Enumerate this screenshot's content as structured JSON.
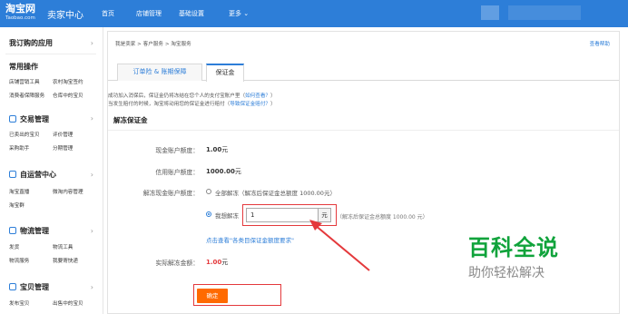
{
  "topbar": {
    "logo": "淘宝网",
    "logo_sub": "Taobao.com",
    "seller_center": "卖家中心",
    "nav": [
      "首页",
      "店铺管理",
      "基础设置",
      "更多 ⌄"
    ]
  },
  "sidebar": {
    "title": "我订购的应用",
    "common_ops": "常用操作",
    "common_items": [
      "店铺营销工具",
      "农村淘宝签约",
      "消费者保障服务",
      "仓库中的宝贝"
    ],
    "sections": [
      {
        "title": "交易管理",
        "items": [
          "已卖出的宝贝",
          "评价管理",
          "采购助手",
          "分期管理"
        ]
      },
      {
        "title": "自运营中心",
        "items": [
          "淘宝直播",
          "微淘内容管理",
          "淘宝群"
        ]
      },
      {
        "title": "物流管理",
        "items": [
          "发货",
          "物流工具",
          "物流服务",
          "我要寄快递"
        ]
      },
      {
        "title": "宝贝管理",
        "items": [
          "发布宝贝",
          "出售中的宝贝"
        ]
      }
    ]
  },
  "main": {
    "breadcrumb": [
      "我是卖家",
      "客户服务",
      "淘宝服务"
    ],
    "help": "查看帮助",
    "tabs": [
      "订单险 & 账期保障",
      "保证金"
    ],
    "tip_line1": "成功加入消保后，保证金仍将冻结在您个人的支付宝账户里（",
    "tip_link1": "如何查看？",
    "tip_line1_end": "）",
    "tip_line2": "当发生赔付的时候，淘宝将动用您的保证金进行赔付（",
    "tip_link2": "导致保证金赔付？",
    "tip_line2_end": "）",
    "section_title": "解冻保证金",
    "cash_label": "现金账户额度：",
    "cash_value": "1.00",
    "cash_unit": "元",
    "credit_label": "信用账户额度：",
    "credit_value": "1000.00",
    "credit_unit": "元",
    "unfreeze_label": "解冻现金账户额度：",
    "option_all": "全部解冻",
    "option_all_hint": "（解冻后保证金总额度 1000.00元）",
    "option_custom": "我想解冻",
    "input_value": "1",
    "input_unit": "元",
    "custom_hint": "（解冻后保证金总额度 1000.00 元）",
    "view_link": "点击查看\"各类目保证金额度要求\"",
    "actual_label": "实际解冻金额：",
    "actual_value": "1.00",
    "actual_unit": "元",
    "confirm": "确定"
  },
  "watermark": {
    "line1": "百科全说",
    "line2": "助你轻松解决"
  },
  "colors": {
    "topbar": "#2d7ed8",
    "accent": "#2d7ed8",
    "button": "#ff6a00",
    "highlight": "#e4393c",
    "watermark": "#10a33b"
  }
}
